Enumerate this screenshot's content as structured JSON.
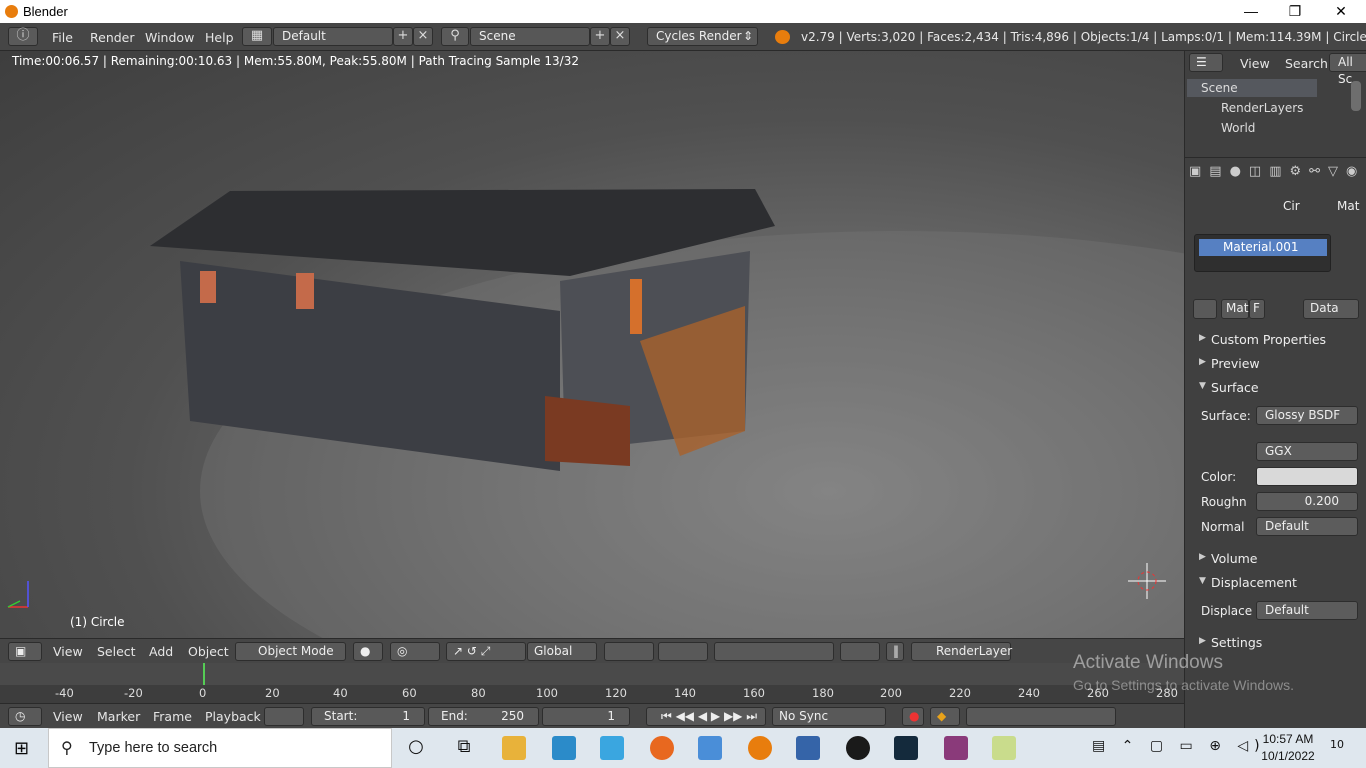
{
  "window": {
    "title": "Blender",
    "min": "—",
    "restore": "❐",
    "close": "✕"
  },
  "menu": [
    "File",
    "Render",
    "Window",
    "Help"
  ],
  "screen_layout": "Default",
  "scene_name": "Scene",
  "render_engine": "Cycles Render",
  "stats": "v2.79 | Verts:3,020 | Faces:2,434 | Tris:4,896 | Objects:1/4 | Lamps:0/1 | Mem:114.39M | Circle",
  "viewport": {
    "render_status": "Time:00:06.57 | Remaining:00:10.63 | Mem:55.80M, Peak:55.80M | Path Tracing Sample 13/32",
    "object_label": "(1) Circle"
  },
  "view3d_header": {
    "menus": [
      "View",
      "Select",
      "Add",
      "Object"
    ],
    "mode": "Object Mode",
    "orientation": "Global",
    "render_layer": "RenderLayer"
  },
  "timeline": {
    "ticks": [
      "-40",
      "-20",
      "0",
      "20",
      "40",
      "60",
      "80",
      "100",
      "120",
      "140",
      "160",
      "180",
      "200",
      "220",
      "240",
      "260",
      "280"
    ],
    "menus": [
      "View",
      "Marker",
      "Frame",
      "Playback"
    ],
    "start_label": "Start:",
    "start": "1",
    "end_label": "End:",
    "end": "250",
    "current": "1",
    "sync": "No Sync"
  },
  "outliner": {
    "menus": [
      "View",
      "Search",
      "All Sc"
    ],
    "items": [
      "Scene",
      "RenderLayers",
      "World"
    ]
  },
  "properties": {
    "breadcrumb_object": "Cir",
    "breadcrumb_material": "Mat",
    "material_slot": "Material.001",
    "mat_field": "Mat",
    "f_label": "F",
    "link": "Data",
    "panels": {
      "custom_properties": "Custom Properties",
      "preview": "Preview",
      "surface": "Surface",
      "volume": "Volume",
      "displacement": "Displacement",
      "settings": "Settings"
    },
    "surface_label": "Surface:",
    "surface_value": "Glossy BSDF",
    "distribution": "GGX",
    "color_label": "Color:",
    "roughness_label": "Roughn",
    "roughness_value": "0.200",
    "normal_label": "Normal",
    "normal_value": "Default",
    "displace_label": "Displace",
    "displace_value": "Default"
  },
  "watermark": {
    "line1": "Activate Windows",
    "line2": "Go to Settings to activate Windows."
  },
  "taskbar": {
    "search_placeholder": "Type here to search",
    "time": "10:57 AM",
    "date": "10/1/2022",
    "notif_count": "10"
  }
}
